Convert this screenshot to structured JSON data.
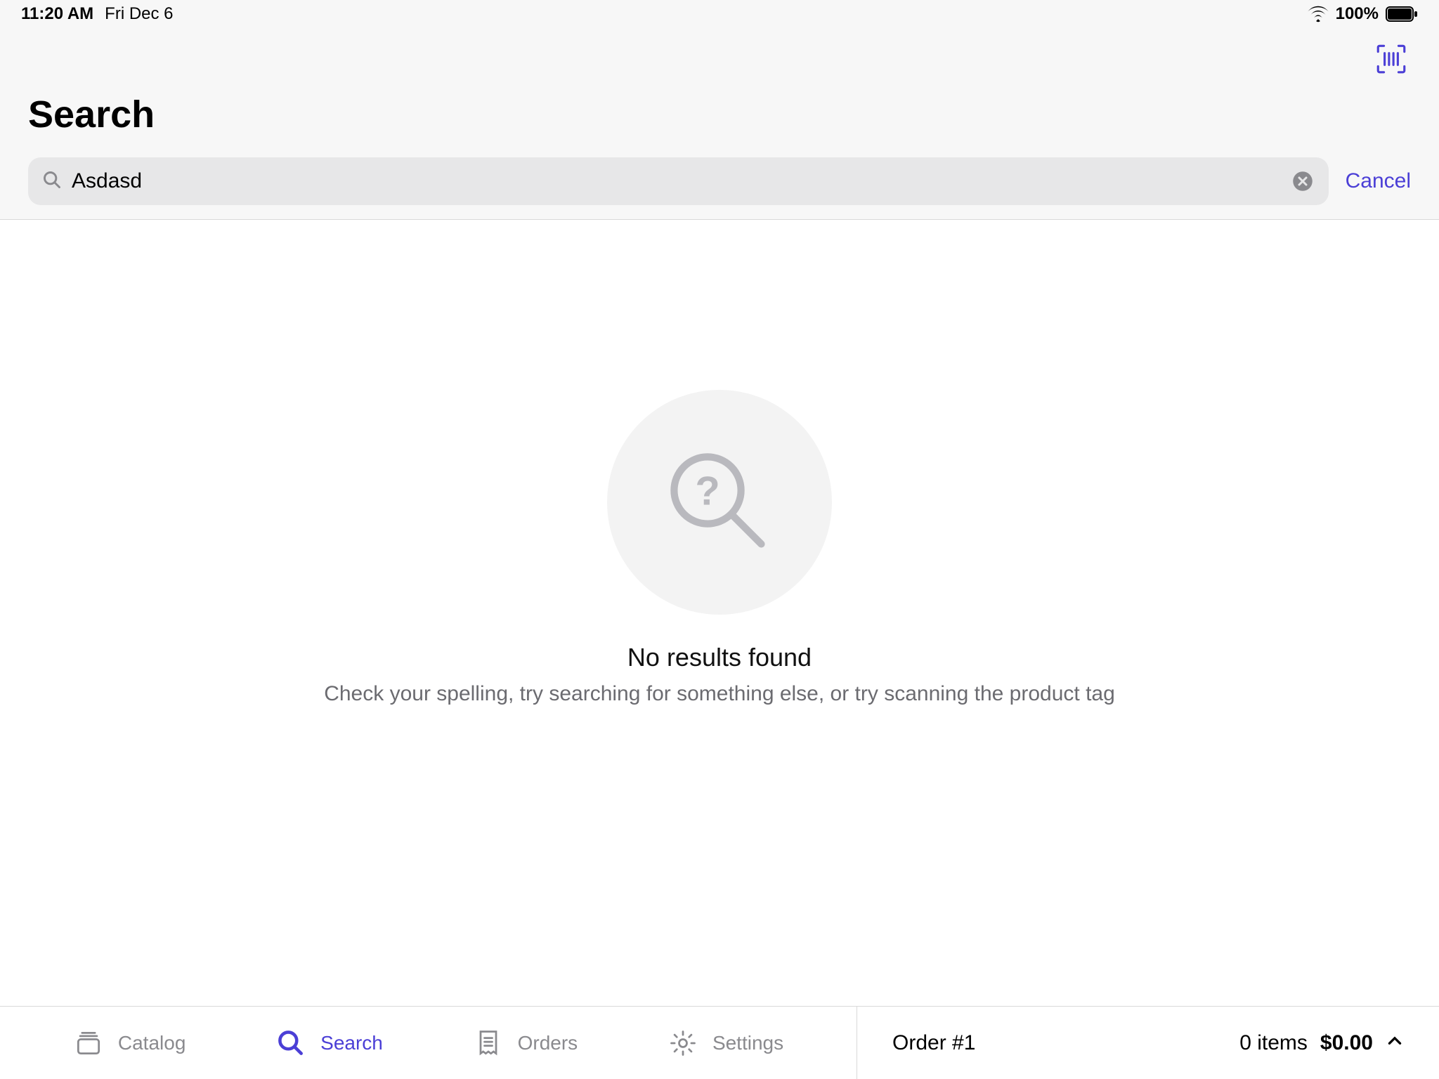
{
  "status_bar": {
    "time": "11:20 AM",
    "date": "Fri Dec 6",
    "battery_pct": "100%"
  },
  "header": {
    "title": "Search"
  },
  "search": {
    "value": "Asdasd",
    "placeholder": "Search",
    "cancel_label": "Cancel"
  },
  "empty_state": {
    "title": "No results found",
    "subtitle": "Check your spelling, try searching for something else, or try scanning the product tag"
  },
  "tabs": [
    {
      "id": "catalog",
      "label": "Catalog",
      "active": false
    },
    {
      "id": "search",
      "label": "Search",
      "active": true
    },
    {
      "id": "orders",
      "label": "Orders",
      "active": false
    },
    {
      "id": "settings",
      "label": "Settings",
      "active": false
    }
  ],
  "order_bar": {
    "label": "Order #1",
    "items_label": "0 items",
    "total": "$0.00"
  },
  "colors": {
    "accent": "#4b3fd6",
    "muted": "#8a8a8e"
  }
}
